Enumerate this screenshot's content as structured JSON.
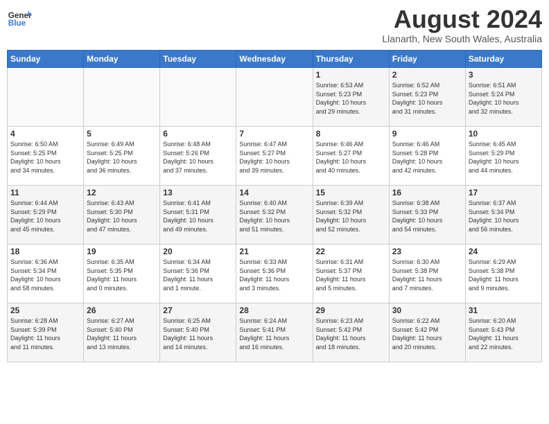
{
  "header": {
    "logo_line1": "General",
    "logo_line2": "Blue",
    "month_year": "August 2024",
    "location": "Llanarth, New South Wales, Australia"
  },
  "weekdays": [
    "Sunday",
    "Monday",
    "Tuesday",
    "Wednesday",
    "Thursday",
    "Friday",
    "Saturday"
  ],
  "weeks": [
    [
      {
        "day": "",
        "info": ""
      },
      {
        "day": "",
        "info": ""
      },
      {
        "day": "",
        "info": ""
      },
      {
        "day": "",
        "info": ""
      },
      {
        "day": "1",
        "info": "Sunrise: 6:53 AM\nSunset: 5:23 PM\nDaylight: 10 hours\nand 29 minutes."
      },
      {
        "day": "2",
        "info": "Sunrise: 6:52 AM\nSunset: 5:23 PM\nDaylight: 10 hours\nand 31 minutes."
      },
      {
        "day": "3",
        "info": "Sunrise: 6:51 AM\nSunset: 5:24 PM\nDaylight: 10 hours\nand 32 minutes."
      }
    ],
    [
      {
        "day": "4",
        "info": "Sunrise: 6:50 AM\nSunset: 5:25 PM\nDaylight: 10 hours\nand 34 minutes."
      },
      {
        "day": "5",
        "info": "Sunrise: 6:49 AM\nSunset: 5:25 PM\nDaylight: 10 hours\nand 36 minutes."
      },
      {
        "day": "6",
        "info": "Sunrise: 6:48 AM\nSunset: 5:26 PM\nDaylight: 10 hours\nand 37 minutes."
      },
      {
        "day": "7",
        "info": "Sunrise: 6:47 AM\nSunset: 5:27 PM\nDaylight: 10 hours\nand 39 minutes."
      },
      {
        "day": "8",
        "info": "Sunrise: 6:46 AM\nSunset: 5:27 PM\nDaylight: 10 hours\nand 40 minutes."
      },
      {
        "day": "9",
        "info": "Sunrise: 6:46 AM\nSunset: 5:28 PM\nDaylight: 10 hours\nand 42 minutes."
      },
      {
        "day": "10",
        "info": "Sunrise: 6:45 AM\nSunset: 5:29 PM\nDaylight: 10 hours\nand 44 minutes."
      }
    ],
    [
      {
        "day": "11",
        "info": "Sunrise: 6:44 AM\nSunset: 5:29 PM\nDaylight: 10 hours\nand 45 minutes."
      },
      {
        "day": "12",
        "info": "Sunrise: 6:43 AM\nSunset: 5:30 PM\nDaylight: 10 hours\nand 47 minutes."
      },
      {
        "day": "13",
        "info": "Sunrise: 6:41 AM\nSunset: 5:31 PM\nDaylight: 10 hours\nand 49 minutes."
      },
      {
        "day": "14",
        "info": "Sunrise: 6:40 AM\nSunset: 5:32 PM\nDaylight: 10 hours\nand 51 minutes."
      },
      {
        "day": "15",
        "info": "Sunrise: 6:39 AM\nSunset: 5:32 PM\nDaylight: 10 hours\nand 52 minutes."
      },
      {
        "day": "16",
        "info": "Sunrise: 6:38 AM\nSunset: 5:33 PM\nDaylight: 10 hours\nand 54 minutes."
      },
      {
        "day": "17",
        "info": "Sunrise: 6:37 AM\nSunset: 5:34 PM\nDaylight: 10 hours\nand 56 minutes."
      }
    ],
    [
      {
        "day": "18",
        "info": "Sunrise: 6:36 AM\nSunset: 5:34 PM\nDaylight: 10 hours\nand 58 minutes."
      },
      {
        "day": "19",
        "info": "Sunrise: 6:35 AM\nSunset: 5:35 PM\nDaylight: 11 hours\nand 0 minutes."
      },
      {
        "day": "20",
        "info": "Sunrise: 6:34 AM\nSunset: 5:36 PM\nDaylight: 11 hours\nand 1 minute."
      },
      {
        "day": "21",
        "info": "Sunrise: 6:33 AM\nSunset: 5:36 PM\nDaylight: 11 hours\nand 3 minutes."
      },
      {
        "day": "22",
        "info": "Sunrise: 6:31 AM\nSunset: 5:37 PM\nDaylight: 11 hours\nand 5 minutes."
      },
      {
        "day": "23",
        "info": "Sunrise: 6:30 AM\nSunset: 5:38 PM\nDaylight: 11 hours\nand 7 minutes."
      },
      {
        "day": "24",
        "info": "Sunrise: 6:29 AM\nSunset: 5:38 PM\nDaylight: 11 hours\nand 9 minutes."
      }
    ],
    [
      {
        "day": "25",
        "info": "Sunrise: 6:28 AM\nSunset: 5:39 PM\nDaylight: 11 hours\nand 11 minutes."
      },
      {
        "day": "26",
        "info": "Sunrise: 6:27 AM\nSunset: 5:40 PM\nDaylight: 11 hours\nand 13 minutes."
      },
      {
        "day": "27",
        "info": "Sunrise: 6:25 AM\nSunset: 5:40 PM\nDaylight: 11 hours\nand 14 minutes."
      },
      {
        "day": "28",
        "info": "Sunrise: 6:24 AM\nSunset: 5:41 PM\nDaylight: 11 hours\nand 16 minutes."
      },
      {
        "day": "29",
        "info": "Sunrise: 6:23 AM\nSunset: 5:42 PM\nDaylight: 11 hours\nand 18 minutes."
      },
      {
        "day": "30",
        "info": "Sunrise: 6:22 AM\nSunset: 5:42 PM\nDaylight: 11 hours\nand 20 minutes."
      },
      {
        "day": "31",
        "info": "Sunrise: 6:20 AM\nSunset: 5:43 PM\nDaylight: 11 hours\nand 22 minutes."
      }
    ]
  ]
}
